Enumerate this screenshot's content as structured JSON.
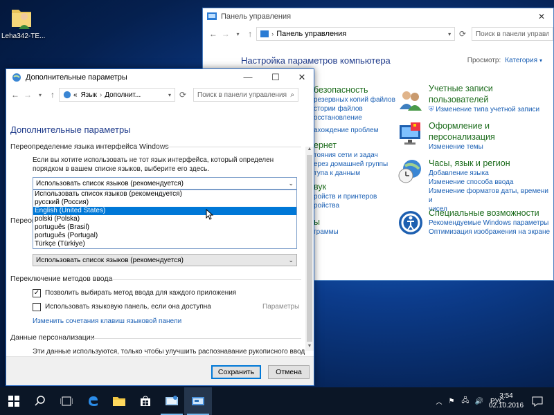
{
  "desktop": {
    "icon_label": "Leha342-TE..."
  },
  "control_panel": {
    "title": "Панель управления",
    "address": "Панель управления",
    "search_placeholder": "Поиск в панели управления",
    "heading": "Настройка параметров компьютера",
    "view_label": "Просмотр:",
    "view_value": "Категория",
    "left_column": [
      {
        "text": "безопасность",
        "kind": "heading"
      },
      {
        "text": "резервных копий файлов",
        "kind": "link"
      },
      {
        "text": "стории файлов",
        "kind": "link"
      },
      {
        "text": "осстановление",
        "kind": "link"
      },
      {
        "text": "ахождение проблем",
        "kind": "link"
      },
      {
        "text": "ернет",
        "kind": "heading"
      },
      {
        "text": "тояния сети и задач",
        "kind": "link"
      },
      {
        "text": "ерез домашней группы",
        "kind": "link"
      },
      {
        "text": "тупа к данным",
        "kind": "link"
      },
      {
        "text": "вук",
        "kind": "heading"
      },
      {
        "text": "ройств и принтеров",
        "kind": "link"
      },
      {
        "text": "ройства",
        "kind": "link"
      },
      {
        "text": "ы",
        "kind": "heading"
      },
      {
        "text": "граммы",
        "kind": "link"
      }
    ],
    "categories": [
      {
        "title1": "Учетные записи",
        "title2": "пользователей",
        "links": [
          "Изменение типа учетной записи"
        ]
      },
      {
        "title1": "Оформление и",
        "title2": "персонализация",
        "links": [
          "Изменение темы"
        ]
      },
      {
        "title1": "Часы, язык и регион",
        "title2": "",
        "links": [
          "Добавление языка",
          "Изменение способа ввода",
          "Изменение форматов даты, времени и",
          "чисел"
        ]
      },
      {
        "title1": "Специальные возможности",
        "title2": "",
        "links": [
          "Рекомендуемые Windows параметры",
          "Оптимизация изображения на экране"
        ]
      }
    ]
  },
  "dialog": {
    "title": "Дополнительные параметры",
    "address_prefix": "«",
    "address_crumbs": [
      "Язык",
      "Дополнит..."
    ],
    "search_placeholder": "Поиск в панели управления",
    "page_title": "Дополнительные параметры",
    "override_ui": {
      "heading": "Переопределение языка интерфейса Windows",
      "description": "Если вы хотите использовать не тот язык интерфейса, который определен порядком в вашем списке языков, выберите его здесь.",
      "selected": "Использовать список языков (рекомендуется)",
      "options": [
        "Использовать список языков (рекомендуется)",
        "русский (Россия)",
        "English (United States)",
        "polski (Polska)",
        "português (Brasil)",
        "português (Portugal)",
        "Türkçe (Türkiye)"
      ],
      "highlighted_index": 2
    },
    "override_input": {
      "heading_partial": "Переоп",
      "selected": "Использовать список языков (рекомендуется)"
    },
    "input_switching": {
      "heading": "Переключение методов ввода",
      "checkbox1_label": "Позволить выбирать метод ввода для каждого приложения",
      "checkbox1_checked": true,
      "checkbox2_label": "Использовать языковую панель, если она доступна",
      "checkbox2_checked": false,
      "params_link": "Параметры",
      "hotkeys_link": "Изменить сочетания клавиш языковой панели"
    },
    "personalization": {
      "heading": "Данные персонализации",
      "description": "Эти данные используются, только чтобы улучшить распознавание рукописного ввода и"
    },
    "save_label": "Сохранить",
    "cancel_label": "Отмена"
  },
  "taskbar": {
    "lang": "РУС",
    "time": "3:54",
    "date": "02.10.2016"
  },
  "colors": {
    "accent": "#0078d7",
    "link": "#1a5fb4",
    "heading_blue": "#1e3a8a",
    "category_green": "#1b6b1b",
    "taskbar": "#0b1626"
  }
}
